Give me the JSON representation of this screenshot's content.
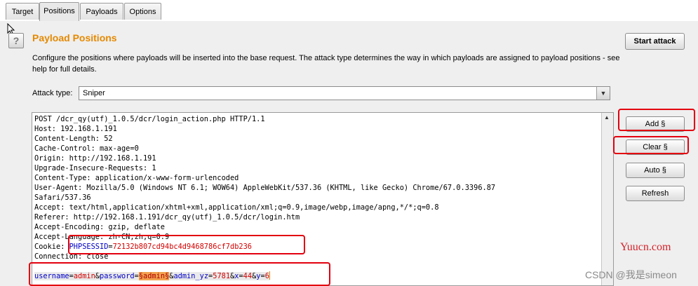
{
  "tabs": [
    {
      "label": "Target"
    },
    {
      "label": "Positions"
    },
    {
      "label": "Payloads"
    },
    {
      "label": "Options"
    }
  ],
  "active_tab": "Positions",
  "help_icon_glyph": "?",
  "section": {
    "title": "Payload Positions",
    "description": "Configure the positions where payloads will be inserted into the base request. The attack type determines the way in which payloads are assigned to payload positions - see help for full details."
  },
  "attack_type": {
    "label": "Attack type:",
    "value": "Sniper"
  },
  "buttons": {
    "start_attack": "Start attack",
    "add": "Add §",
    "clear": "Clear §",
    "auto": "Auto §",
    "refresh": "Refresh"
  },
  "request": {
    "lines": [
      "POST /dcr_qy(utf)_1.0.5/dcr/login_action.php HTTP/1.1",
      "Host: 192.168.1.191",
      "Content-Length: 52",
      "Cache-Control: max-age=0",
      "Origin: http://192.168.1.191",
      "Upgrade-Insecure-Requests: 1",
      "Content-Type: application/x-www-form-urlencoded",
      "User-Agent: Mozilla/5.0 (Windows NT 6.1; WOW64) AppleWebKit/537.36 (KHTML, like Gecko) Chrome/67.0.3396.87",
      "Safari/537.36",
      "Accept: text/html,application/xhtml+xml,application/xml;q=0.9,image/webp,image/apng,*/*;q=0.8",
      "Referer: http://192.168.1.191/dcr_qy(utf)_1.0.5/dcr/login.htm",
      "Accept-Encoding: gzip, deflate",
      "Accept-Language: zh-CN,zh;q=0.9"
    ],
    "cookie_key": "Cookie: ",
    "cookie_name": "PHPSESSID",
    "cookie_eq": "=",
    "cookie_value": "72132b807cd94bc4d9468786cf7db236",
    "connection": "Connection: close",
    "body": {
      "p1": "username",
      "e1": "=",
      "v1": "admin",
      "a1": "&",
      "p2": "password",
      "e2": "=",
      "payload": "§admin§",
      "a2": "&",
      "p3": "admin_yz",
      "e3": "=",
      "v3": "5781",
      "a3": "&",
      "p4": "x",
      "e4": "=",
      "v4": "44",
      "a4": "&",
      "p5": "y",
      "e5": "=",
      "v5": "6"
    }
  },
  "watermarks": {
    "site": "Yuucn.com",
    "csdn": "CSDN @我是simeon"
  },
  "colors": {
    "section_title": "#e58900",
    "highlight_box": "#e3000f",
    "param_name": "#0000c8",
    "param_value": "#d40000",
    "payload_bg": "#f2a350"
  }
}
